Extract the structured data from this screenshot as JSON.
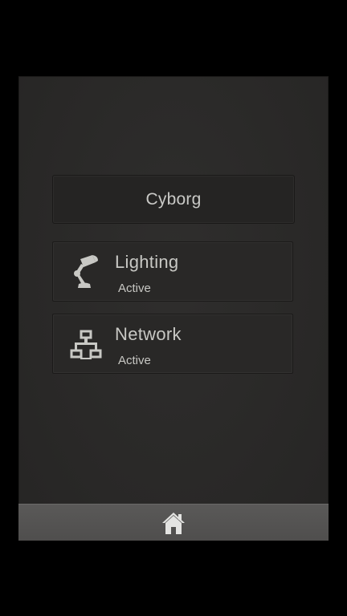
{
  "header": {
    "title": "Cyborg"
  },
  "devices": [
    {
      "name": "Lighting",
      "status": "Active",
      "icon": "desk-lamp-icon"
    },
    {
      "name": "Network",
      "status": "Active",
      "icon": "network-icon"
    }
  ],
  "footer": {
    "home_icon": "home-icon"
  },
  "colors": {
    "background": "#2a2928",
    "text": "#c8c8c4",
    "icon": "#c8c8c4",
    "bottom_bar": "#545352"
  }
}
